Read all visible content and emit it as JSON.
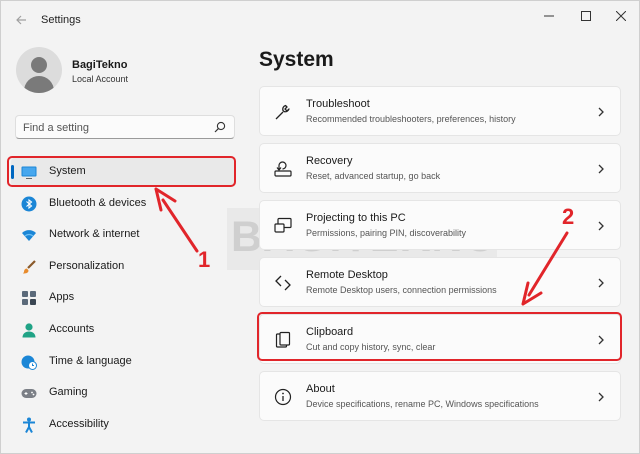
{
  "window": {
    "title": "Settings",
    "back_icon": "arrow-left-icon",
    "controls": [
      "minimize-icon",
      "maximize-icon",
      "close-icon"
    ]
  },
  "profile": {
    "name": "BagiTekno",
    "account_type": "Local Account"
  },
  "search": {
    "placeholder": "Find a setting",
    "icon": "search-icon"
  },
  "sidebar": {
    "accent_color": "#0067c0",
    "items": [
      {
        "label": "System",
        "icon": "monitor-icon",
        "active": true
      },
      {
        "label": "Bluetooth & devices",
        "icon": "bluetooth-icon"
      },
      {
        "label": "Network & internet",
        "icon": "wifi-icon"
      },
      {
        "label": "Personalization",
        "icon": "brush-icon"
      },
      {
        "label": "Apps",
        "icon": "apps-grid-icon"
      },
      {
        "label": "Accounts",
        "icon": "person-icon"
      },
      {
        "label": "Time & language",
        "icon": "globe-clock-icon"
      },
      {
        "label": "Gaming",
        "icon": "gamepad-icon"
      },
      {
        "label": "Accessibility",
        "icon": "accessibility-icon"
      }
    ]
  },
  "main": {
    "title": "System",
    "cards": [
      {
        "title": "Troubleshoot",
        "subtitle": "Recommended troubleshooters, preferences, history",
        "icon": "wrench-icon"
      },
      {
        "title": "Recovery",
        "subtitle": "Reset, advanced startup, go back",
        "icon": "recovery-icon"
      },
      {
        "title": "Projecting to this PC",
        "subtitle": "Permissions, pairing PIN, discoverability",
        "icon": "projecting-icon"
      },
      {
        "title": "Remote Desktop",
        "subtitle": "Remote Desktop users, connection permissions",
        "icon": "remote-desktop-icon"
      },
      {
        "title": "Clipboard",
        "subtitle": "Cut and copy history, sync, clear",
        "icon": "clipboard-icon"
      },
      {
        "title": "About",
        "subtitle": "Device specifications, rename PC, Windows specifications",
        "icon": "info-icon"
      }
    ]
  },
  "annotations": {
    "color": "#e1252a",
    "step1": "1",
    "step2": "2"
  },
  "watermark": {
    "text": "BAGITEKNO"
  }
}
